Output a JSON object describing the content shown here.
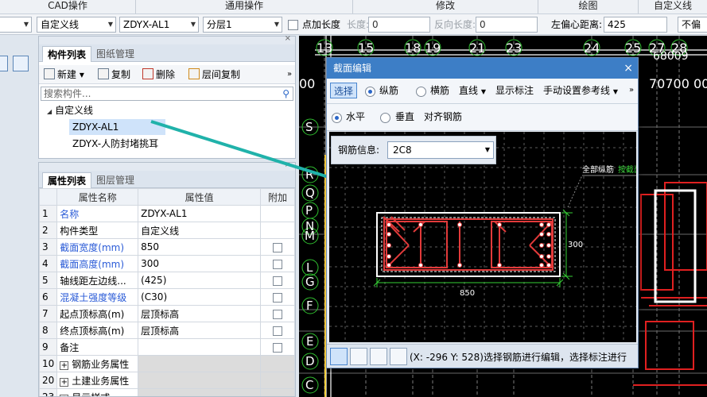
{
  "ribbon": {
    "groups": [
      "CAD操作",
      "通用操作",
      "修改",
      "绘图",
      "自定义线"
    ]
  },
  "propbar": {
    "combo0_value": "",
    "line_type": "自定义线",
    "component": "ZDYX-AL1",
    "floor": "分层1",
    "add_length_label": "点加长度",
    "length_label": "长度:",
    "length_value": "0",
    "reverse_length_label": "反向长度:",
    "reverse_length_value": "0",
    "left_offset_label": "左偏心距离:",
    "left_offset_value": "425",
    "last_combo": "不偏移"
  },
  "component_panel": {
    "tabs": [
      "构件列表",
      "图纸管理"
    ],
    "toolbar": [
      "新建",
      "复制",
      "删除",
      "层间复制"
    ],
    "search_placeholder": "搜索构件...",
    "tree_root": "自定义线",
    "tree_items": [
      "ZDYX-AL1",
      "ZDYX-人防封堵挑耳"
    ]
  },
  "property_panel": {
    "tabs": [
      "属性列表",
      "图层管理"
    ],
    "headers": [
      "属性名称",
      "属性值",
      "附加"
    ],
    "rows": [
      {
        "n": "1",
        "name": "名称",
        "value": "ZDYX-AL1",
        "blue": true,
        "check": false
      },
      {
        "n": "2",
        "name": "构件类型",
        "value": "自定义线",
        "blue": false,
        "check": false
      },
      {
        "n": "3",
        "name": "截面宽度(mm)",
        "value": "850",
        "blue": true,
        "check": true
      },
      {
        "n": "4",
        "name": "截面高度(mm)",
        "value": "300",
        "blue": true,
        "check": true
      },
      {
        "n": "5",
        "name": "轴线距左边线...",
        "value": "(425)",
        "blue": false,
        "check": true
      },
      {
        "n": "6",
        "name": "混凝土强度等级",
        "value": "(C30)",
        "blue": true,
        "check": true
      },
      {
        "n": "7",
        "name": "起点顶标高(m)",
        "value": "层顶标高",
        "blue": false,
        "check": true
      },
      {
        "n": "8",
        "name": "终点顶标高(m)",
        "value": "层顶标高",
        "blue": false,
        "check": true
      },
      {
        "n": "9",
        "name": "备注",
        "value": "",
        "blue": false,
        "check": true
      },
      {
        "n": "10",
        "name": "钢筋业务属性",
        "value": "",
        "blue": false,
        "check": false,
        "plus": true
      },
      {
        "n": "20",
        "name": "土建业务属性",
        "value": "",
        "blue": false,
        "check": false,
        "plus": true
      },
      {
        "n": "23",
        "name": "显示样式",
        "value": "",
        "blue": false,
        "check": false,
        "plus": true
      }
    ]
  },
  "cad": {
    "grid_top": [
      "13",
      "15",
      "18",
      "19",
      "21",
      "23",
      "24",
      "25",
      "27",
      "28"
    ],
    "grid_top_sub": "68009",
    "grid_left": [
      "S",
      "R",
      "Q",
      "P",
      "N",
      "M",
      "L",
      "G",
      "F",
      "E",
      "D",
      "C"
    ],
    "dim_right": "00",
    "dim_right2": "70700",
    "dim_left": "00"
  },
  "dialog": {
    "title": "截面编辑",
    "close": "×",
    "tb1": {
      "select": "选择",
      "long_bar": "纵筋",
      "stirrup": "横筋",
      "line": "直线",
      "show_dim": "显示标注",
      "ref_line": "手动设置参考线",
      "more": "»"
    },
    "tb2": {
      "horizontal": "水平",
      "vertical": "垂直",
      "align": "对齐钢筋"
    },
    "rebar_info_label": "钢筋信息:",
    "rebar_info_value": "2C8",
    "annotation": "全部纵筋",
    "annotation_green": "按截面",
    "dim_width": "850",
    "dim_height": "300",
    "status_text": "(X: -296 Y: 528)选择钢筋进行编辑，选择标注进行"
  }
}
